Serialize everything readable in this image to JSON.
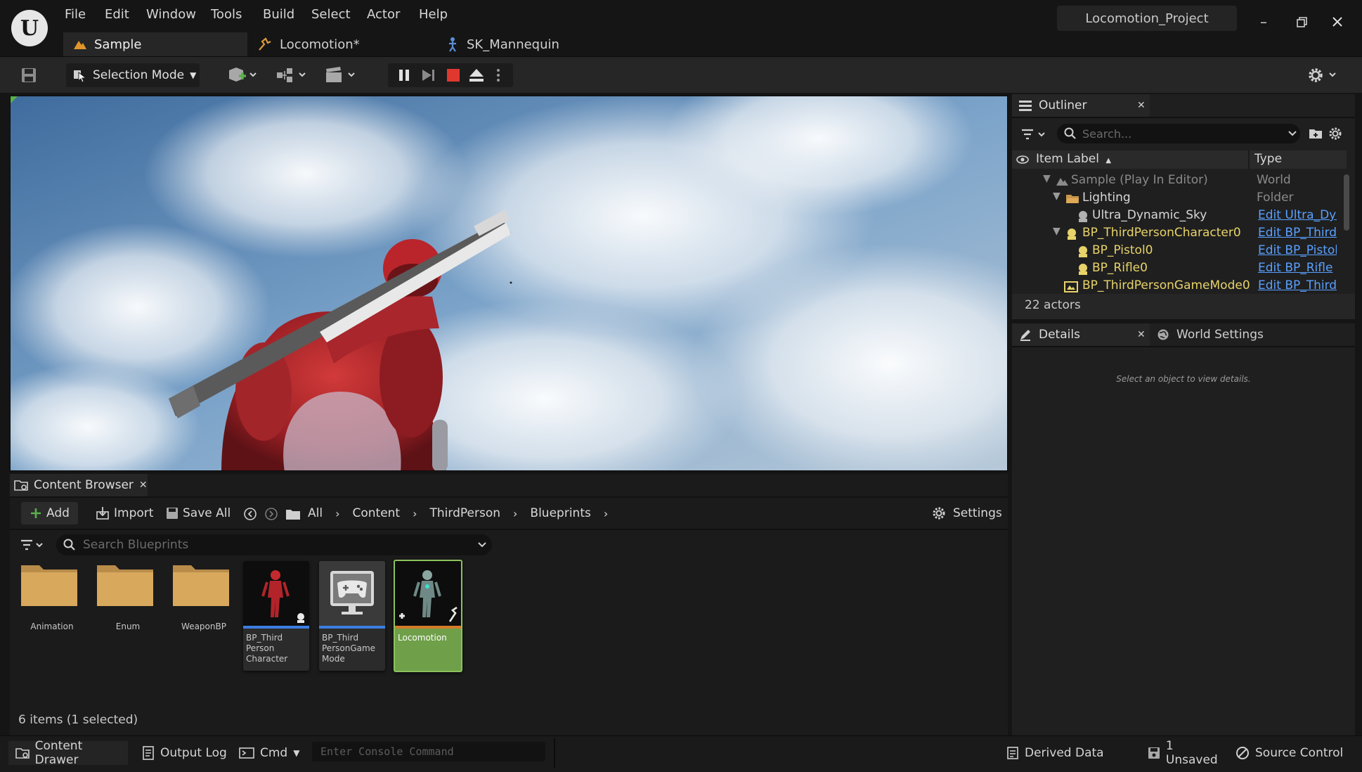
{
  "menu": [
    "File",
    "Edit",
    "Window",
    "Tools",
    "Build",
    "Select",
    "Actor",
    "Help"
  ],
  "project_name": "Locomotion_Project",
  "doc_tabs": [
    {
      "label": "Sample",
      "active": true,
      "icon": "level-icon"
    },
    {
      "label": "Locomotion*",
      "active": false,
      "icon": "anim-blueprint-icon"
    },
    {
      "label": "SK_Mannequin",
      "active": false,
      "icon": "skeleton-icon"
    }
  ],
  "toolbar": {
    "selection_mode": "Selection Mode"
  },
  "outliner": {
    "tab_label": "Outliner",
    "search_placeholder": "Search...",
    "col_item_label": "Item Label",
    "col_type": "Type",
    "rows": [
      {
        "label": "Sample (Play In Editor)",
        "type": "World",
        "color": "muted",
        "link": false,
        "indent": 0
      },
      {
        "label": "Lighting",
        "type": "Folder",
        "color": "normal",
        "link": false,
        "indent": 1
      },
      {
        "label": "Ultra_Dynamic_Sky",
        "type": "Edit Ultra_Dyr",
        "color": "normal",
        "link": true,
        "indent": 2
      },
      {
        "label": "BP_ThirdPersonCharacter0",
        "type": "Edit BP_Thirdl",
        "color": "yellow",
        "link": true,
        "indent": 1
      },
      {
        "label": "BP_Pistol0",
        "type": "Edit BP_Pistol",
        "color": "yellow",
        "link": true,
        "indent": 2
      },
      {
        "label": "BP_Rifle0",
        "type": "Edit BP_Rifle",
        "color": "yellow",
        "link": true,
        "indent": 2
      },
      {
        "label": "BP_ThirdPersonGameMode0",
        "type": "Edit BP_Thirdl",
        "color": "yellow",
        "link": true,
        "indent": 1
      }
    ],
    "actor_count": "22 actors"
  },
  "details": {
    "tab_label": "Details",
    "world_settings_label": "World Settings",
    "empty_message": "Select an object to view details."
  },
  "content_browser": {
    "tab_label": "Content Browser",
    "add_label": "Add",
    "import_label": "Import",
    "save_all_label": "Save All",
    "breadcrumb": [
      "All",
      "Content",
      "ThirdPerson",
      "Blueprints"
    ],
    "settings_label": "Settings",
    "search_placeholder": "Search Blueprints",
    "folders": [
      "Animation",
      "Enum",
      "WeaponBP"
    ],
    "assets": [
      {
        "label": "BP_Third Person Character",
        "lines": [
          "BP_Third",
          "Person",
          "Character"
        ],
        "strip": "#3c7de0"
      },
      {
        "label": "BP_Third PersonGame Mode",
        "lines": [
          "BP_Third",
          "PersonGame",
          "Mode"
        ],
        "strip": "#3c7de0"
      },
      {
        "label": "Locomotion",
        "lines": [
          "Locomotion"
        ],
        "strip": "#d37b2a",
        "selected": true
      }
    ],
    "item_count": "6 items (1 selected)"
  },
  "statusbar": {
    "content_drawer": "Content Drawer",
    "output_log": "Output Log",
    "cmd": "Cmd",
    "console_placeholder": "Enter Console Command",
    "derived_data": "Derived Data",
    "unsaved": "1 Unsaved",
    "source_control": "Source Control"
  },
  "colors": {
    "accent_blue": "#3c7de0",
    "selected_green": "#6f9f49",
    "stop_red": "#e0382e",
    "link_blue": "#5aa0ff"
  }
}
